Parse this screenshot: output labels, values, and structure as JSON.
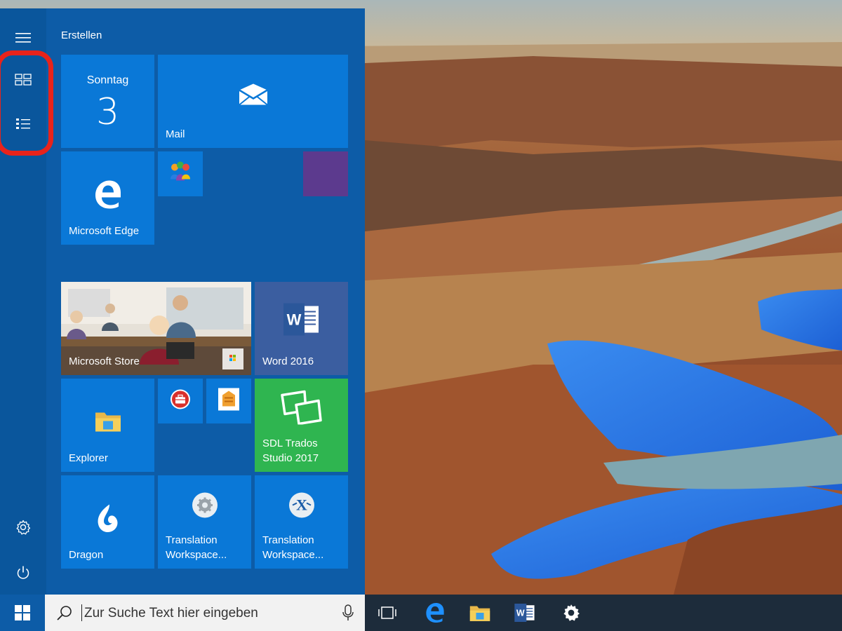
{
  "start_menu": {
    "group_title": "Erstellen",
    "tiles": {
      "calendar": {
        "day": "Sonntag",
        "date": "3"
      },
      "mail": {
        "label": "Mail"
      },
      "edge": {
        "label": "Microsoft Edge"
      },
      "store": {
        "label": "Microsoft Store"
      },
      "word": {
        "label": "Word 2016"
      },
      "explorer": {
        "label": "Explorer"
      },
      "trados": {
        "label": "SDL Trados\nStudio 2017"
      },
      "dragon": {
        "label": "Dragon"
      },
      "tw1": {
        "label": "Translation\nWorkspace..."
      },
      "tw2": {
        "label": "Translation\nWorkspace..."
      }
    },
    "colors": {
      "menu_bg": "#0d5ca7",
      "tile_blue": "#0a78d7",
      "tile_green": "#2fb550",
      "tile_purple": "#5c3a8e",
      "highlight": "#e8231b"
    }
  },
  "taskbar": {
    "search_placeholder": "Zur Suche Text hier eingeben",
    "icons": [
      "windows-logo-icon",
      "task-view-icon",
      "edge-icon",
      "file-explorer-icon",
      "word-icon",
      "settings-icon"
    ]
  }
}
